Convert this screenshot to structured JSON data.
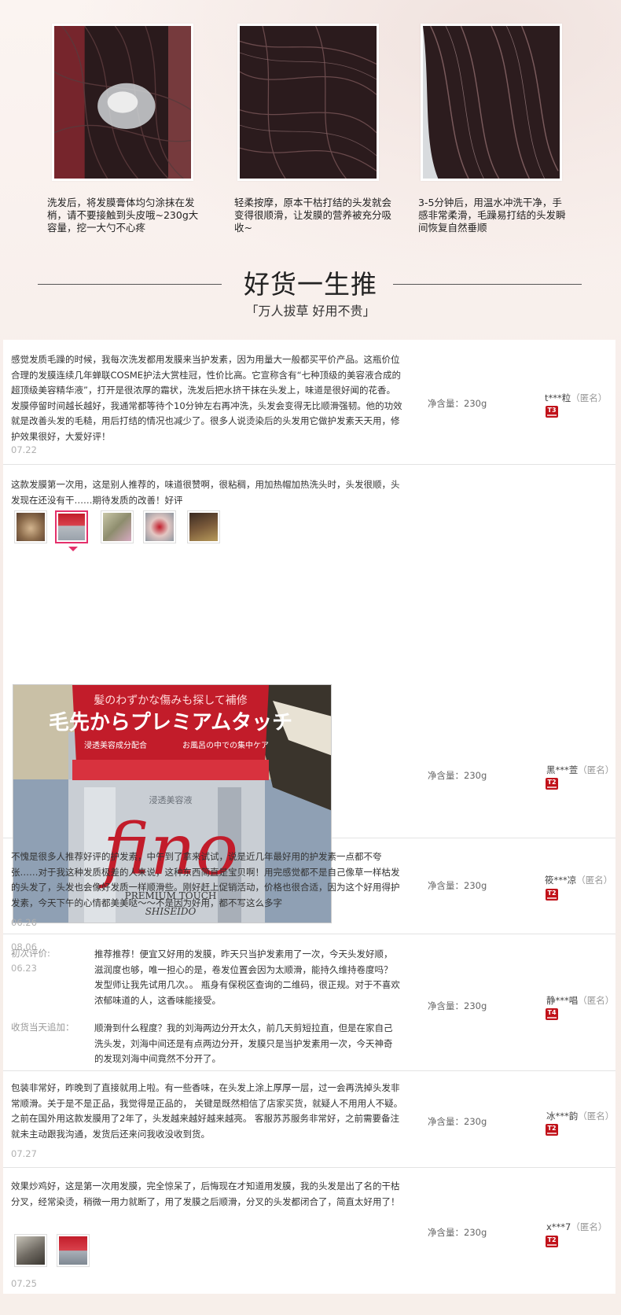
{
  "steps": [
    {
      "text": "洗发后，将发膜膏体均匀涂抹在发梢，请不要接触到头皮哦~230g大容量，挖一大勺不心疼"
    },
    {
      "text": "轻柔按摩，原本干枯打结的头发就会变得很顺滑，让发膜的营养被充分吸收~"
    },
    {
      "text": "3-5分钟后，用温水冲洗干净，手感非常柔滑，毛躁易打结的头发瞬间恢复自然垂顺"
    }
  ],
  "section": {
    "title": "好货一生推",
    "subtitle": "「万人拔草 好用不贵」"
  },
  "reviews": [
    {
      "text": "感觉发质毛躁的时候，我每次洗发都用发膜来当护发素，因为用量大一般都买平价产品。这瓶价位合理的发膜连续几年蝉联COSME护法大赏桂冠，性价比高。它宣称含有“七种顶级的美容液合成的超顶级美容精华液”，打开是很浓厚的霜状，洗发后把水挤干抹在头发上，味道是很好闻的花香。发膜停留时间越长越好，我通常都等待个10分钟左右再冲洗，头发会变得无比顺滑强韧。他的功效就是改善头发的毛糙，用后打结的情况也减少了。很多人说烫染后的头发用它做护发素天天用，修护效果很好，大爱好评！",
      "date": "07.22",
      "spec": "净含量：230g",
      "user": "t***粒",
      "anon": "（匿名）",
      "badge": "T3"
    },
    {
      "text": "这款发膜第一次用，这是别人推荐的，味道很赞啊，很粘稠，用加热帽加热洗头时，头发很顺，头发现在还没有干……期待发质的改善！好评",
      "date": "08.06",
      "spec": "净含量：230g",
      "user": "黑***萱",
      "anon": "（匿名）",
      "badge": "T2",
      "photo_text": {
        "line1": "髪のわずかな傷みも探して補修",
        "line2": "毛先からプレミアムタッチ",
        "line3": "浸透美容成分配合",
        "line4": "お風呂の中での集中ケア",
        "brand": "fino",
        "sub": "PREMIUM TOUCH",
        "maker": "SHISEIDO",
        "tag": "浸透美容液"
      }
    },
    {
      "text": "不愧是很多人推荐好评的护发素，中午到了拿来试试，说是近几年最好用的护发素一点都不夸张……对于我这种发质极差的人来说，这种东西简直是宝贝啊！用完感觉都不是自己像草一样枯发的头发了，头发也会像好发质一样顺滑些。刚好赶上促销活动，价格也很合适，因为这个好用得护发素，今天下午的心情都美美哒～～不是因为好用，都不写这么多字",
      "date": "06.26",
      "spec": "净含量：230g",
      "user": "筱***凉",
      "anon": "（匿名）",
      "badge": "T2"
    },
    {
      "first_label": "初次评价:",
      "date": "06.23",
      "text": "推荐推荐！便宜又好用的发膜，昨天只当护发素用了一次，今天头发好顺，滋润度也够，唯一担心的是，卷发位置会因为太顺滑，能持久维持卷度吗？发型师让我先试用几次。。 瓶身有保税区查询的二维码，很正规。对于不喜欢浓郁味道的人，这香味能接受。",
      "append_label": "收货当天追加：",
      "append_text": "顺滑到什么程度？我的刘海两边分开太久，前几天剪短拉直，但是在家自己洗头发，刘海中间还是有点两边分开，发膜只是当护发素用一次，今天神奇的发现刘海中间竟然不分开了。",
      "spec": "净含量：230g",
      "user": "静***唱",
      "anon": "（匿名）",
      "badge": "T4"
    },
    {
      "text": "包装非常好，昨晚到了直接就用上啦。有一些香味，在头发上涂上厚厚一层，过一会再洗掉头发非常顺滑。关于是不是正品，我觉得是正品的， 关键是既然相信了店家买货，就疑人不用用人不疑。之前在国外用这款发膜用了2年了，头发越来越好越来越亮。 客服苏苏服务非常好，之前需要备注就未主动跟我沟通，发货后还来问我收没收到货。",
      "date": "07.27",
      "spec": "净含量：230g",
      "user": "冰***韵",
      "anon": "（匿名）",
      "badge": "T2"
    },
    {
      "text": "效果炒鸡好，这是第一次用发膜，完全惊呆了，后悔现在才知道用发膜，我的头发是出了名的干枯分叉，经常染烫，稍微一用力就断了，用了发膜之后顺滑，分叉的头发都闭合了，简直太好用了！",
      "date": "07.25",
      "spec": "净含量：230g",
      "user": "x***7",
      "anon": "（匿名）",
      "badge": "T2"
    }
  ],
  "colors": {
    "accent": "#e4306b",
    "badge": "#c1121a",
    "date": "#b0b0b0"
  }
}
